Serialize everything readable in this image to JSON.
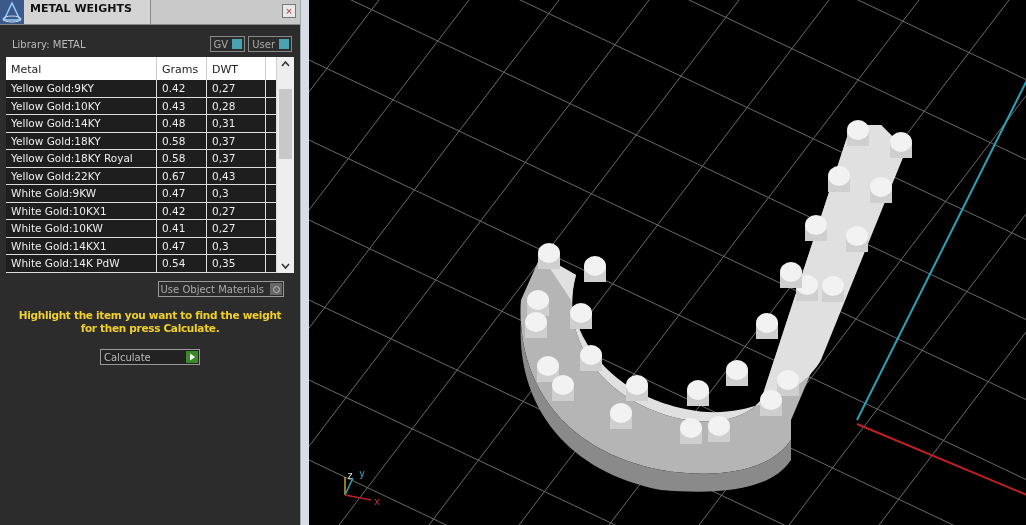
{
  "panel": {
    "title": "METAL WEIGHTS",
    "close": "×",
    "library": "Library: METAL",
    "toggles": [
      {
        "label": "GV",
        "on": true
      },
      {
        "label": "User",
        "on": true
      }
    ],
    "table": {
      "columns": [
        "Metal",
        "Grams",
        "DWT"
      ],
      "rows": [
        {
          "metal": "Yellow Gold:9KY",
          "grams": "0.42",
          "dwt": "0,27",
          "selected": false
        },
        {
          "metal": "Yellow Gold:10KY",
          "grams": "0.43",
          "dwt": "0,28",
          "selected": false
        },
        {
          "metal": "Yellow Gold:14KY",
          "grams": "0.48",
          "dwt": "0,31",
          "selected": false
        },
        {
          "metal": "Yellow Gold:18KY",
          "grams": "0.58",
          "dwt": "0,37",
          "selected": false
        },
        {
          "metal": "Yellow Gold:18KY Royal",
          "grams": "0.58",
          "dwt": "0,37",
          "selected": false
        },
        {
          "metal": "Yellow Gold:22KY",
          "grams": "0.67",
          "dwt": "0,43",
          "selected": false
        },
        {
          "metal": "White Gold:9KW",
          "grams": "0.47",
          "dwt": "0,3",
          "selected": false
        },
        {
          "metal": "White Gold:10KX1",
          "grams": "0.42",
          "dwt": "0,27",
          "selected": false
        },
        {
          "metal": "White Gold:10KW",
          "grams": "0.41",
          "dwt": "0,27",
          "selected": false
        },
        {
          "metal": "White Gold:14KX1",
          "grams": "0.47",
          "dwt": "0,3",
          "selected": false
        },
        {
          "metal": "White Gold:14K PdW",
          "grams": "0.54",
          "dwt": "0,35",
          "selected": false
        }
      ]
    },
    "use_object_materials": {
      "label": "Use Object Materials",
      "on": false
    },
    "hint": "Highlight the item you want to find the weight for then press Calculate.",
    "calculate": "Calculate"
  },
  "viewport": {
    "axes": [
      "z",
      "y",
      "x"
    ]
  }
}
